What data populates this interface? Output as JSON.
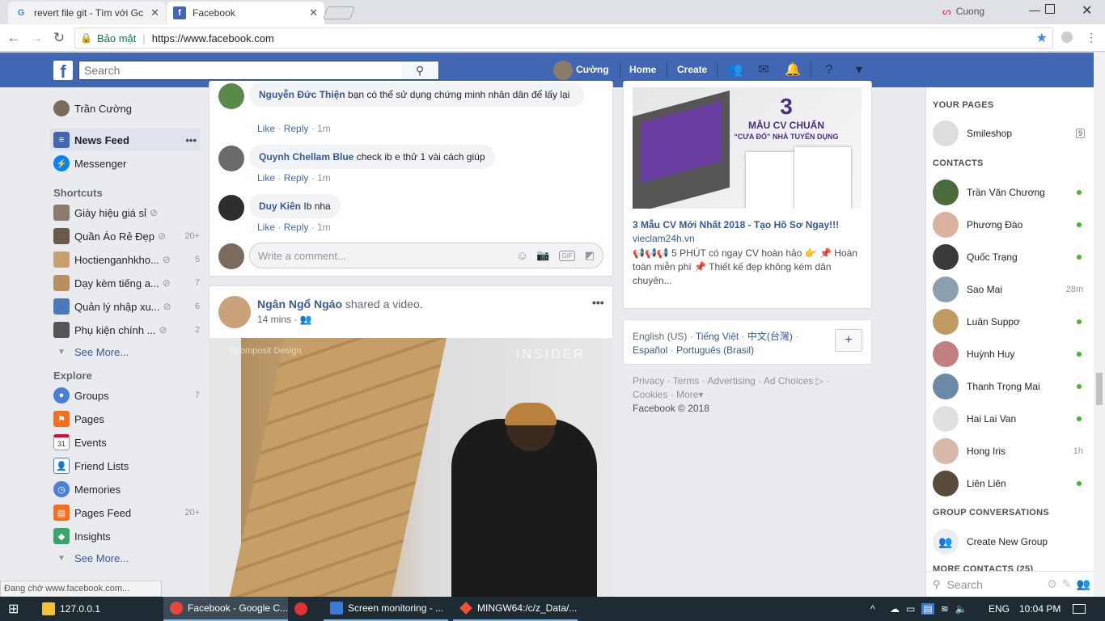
{
  "browser": {
    "tabs": [
      {
        "title": "revert file git - Tìm với Gc",
        "active": false
      },
      {
        "title": "Facebook",
        "active": true
      }
    ],
    "profile_name": "Cuong",
    "secure_label": "Bảo mật",
    "url": "https://www.facebook.com",
    "status_text": "Đang chờ www.facebook.com..."
  },
  "fb_header": {
    "logo": "f",
    "search_placeholder": "Search",
    "user_name": "Cường",
    "home": "Home",
    "create": "Create",
    "accent": "#4267b2"
  },
  "left_nav": {
    "profile": "Trần Cường",
    "news_feed": "News Feed",
    "news_feed_more": "•••",
    "messenger": "Messenger",
    "shortcuts_title": "Shortcuts",
    "shortcuts": [
      {
        "label": "Giày hiệu giá sỉ",
        "count": ""
      },
      {
        "label": "Quần Áo Rẻ Đẹp",
        "count": "20+"
      },
      {
        "label": "Hoctienganhkho...",
        "count": "5"
      },
      {
        "label": "Dạy kèm tiếng a...",
        "count": "7"
      },
      {
        "label": "Quản lý nhập xu...",
        "count": "6"
      },
      {
        "label": "Phụ kiện chính ...",
        "count": "2"
      }
    ],
    "see_more": "See More...",
    "explore_title": "Explore",
    "explore": [
      {
        "label": "Groups",
        "count": "7"
      },
      {
        "label": "Pages",
        "count": ""
      },
      {
        "label": "Events",
        "count": ""
      },
      {
        "label": "Friend Lists",
        "count": ""
      },
      {
        "label": "Memories",
        "count": ""
      },
      {
        "label": "Pages Feed",
        "count": "20+"
      },
      {
        "label": "Insights",
        "count": ""
      }
    ],
    "events_day": "31",
    "see_more_2": "See More..."
  },
  "comments": [
    {
      "name": "Nguyễn Đức Thiện",
      "text": "bạn có thể sử dụng chứng minh nhân dân để lấy lại",
      "time": "1m"
    },
    {
      "name": "Quynh Chellam Blue",
      "text": "check ib e thử 1 vài cách giúp",
      "time": "1m"
    },
    {
      "name": "Duy Kiên",
      "text": "Ib nha",
      "time": "1m"
    }
  ],
  "comment_actions": {
    "like": "Like",
    "reply": "Reply",
    "sep": "·"
  },
  "write_comment_placeholder": "Write a comment...",
  "post": {
    "author": "Ngân Ngổ Ngáo",
    "action": "shared a video.",
    "time": "14 mins",
    "video_brand": "INSIDER",
    "video_watermark": "Bcomposit Design"
  },
  "ad": {
    "image_big_number": "3",
    "image_line1": "MẪU CV CHUẨN",
    "image_line2": "“CƯA ĐỔ” NHÀ TUYỂN DỤNG",
    "title": "3 Mẫu CV Mới Nhất 2018 - Tạo Hồ Sơ Ngay!!!",
    "domain": "vieclam24h.vn",
    "desc": "📢📢📢 5 PHÚT có ngay CV hoàn hảo 👉 📌 Hoàn toàn miễn phí 📌 Thiết kế đẹp không kém dân chuyên..."
  },
  "languages": {
    "current": "English (US)",
    "options": [
      "Tiếng Việt",
      "中文(台灣)",
      "Español",
      "Português (Brasil)"
    ],
    "add": "+"
  },
  "footer": {
    "links": [
      "Privacy",
      "Terms",
      "Advertising",
      "Ad Choices",
      "Cookies",
      "More"
    ],
    "copyright": "Facebook © 2018"
  },
  "right_sidebar": {
    "your_pages_title": "YOUR PAGES",
    "page_name": "Smileshop",
    "page_badge": "9",
    "contacts_title": "CONTACTS",
    "contacts": [
      {
        "name": "Trần Văn Chương",
        "status": "online",
        "time": ""
      },
      {
        "name": "Phương Đào",
        "status": "online",
        "time": ""
      },
      {
        "name": "Quốc Trạng",
        "status": "online",
        "time": ""
      },
      {
        "name": "Sao Mai",
        "status": "idle",
        "time": "28m"
      },
      {
        "name": "Luân Suppơ",
        "status": "online",
        "time": ""
      },
      {
        "name": "Huỳnh Huy",
        "status": "online",
        "time": ""
      },
      {
        "name": "Thanh Trọng Mai",
        "status": "online",
        "time": ""
      },
      {
        "name": "Hai Lai Van",
        "status": "online",
        "time": ""
      },
      {
        "name": "Hong Iris",
        "status": "idle",
        "time": "1h"
      },
      {
        "name": "Liên Liên",
        "status": "online",
        "time": ""
      }
    ],
    "group_conv_title": "GROUP CONVERSATIONS",
    "create_group": "Create New Group",
    "more_contacts": "MORE CONTACTS (25)",
    "search_placeholder": "Search"
  },
  "taskbar": {
    "items": [
      {
        "label": "127.0.0.1"
      },
      {
        "label": "Facebook - Google C..."
      },
      {
        "label": ""
      },
      {
        "label": "Screen monitoring - ..."
      },
      {
        "label": "MINGW64:/c/z_Data/..."
      }
    ],
    "lang": "ENG",
    "time": "10:04 PM"
  }
}
